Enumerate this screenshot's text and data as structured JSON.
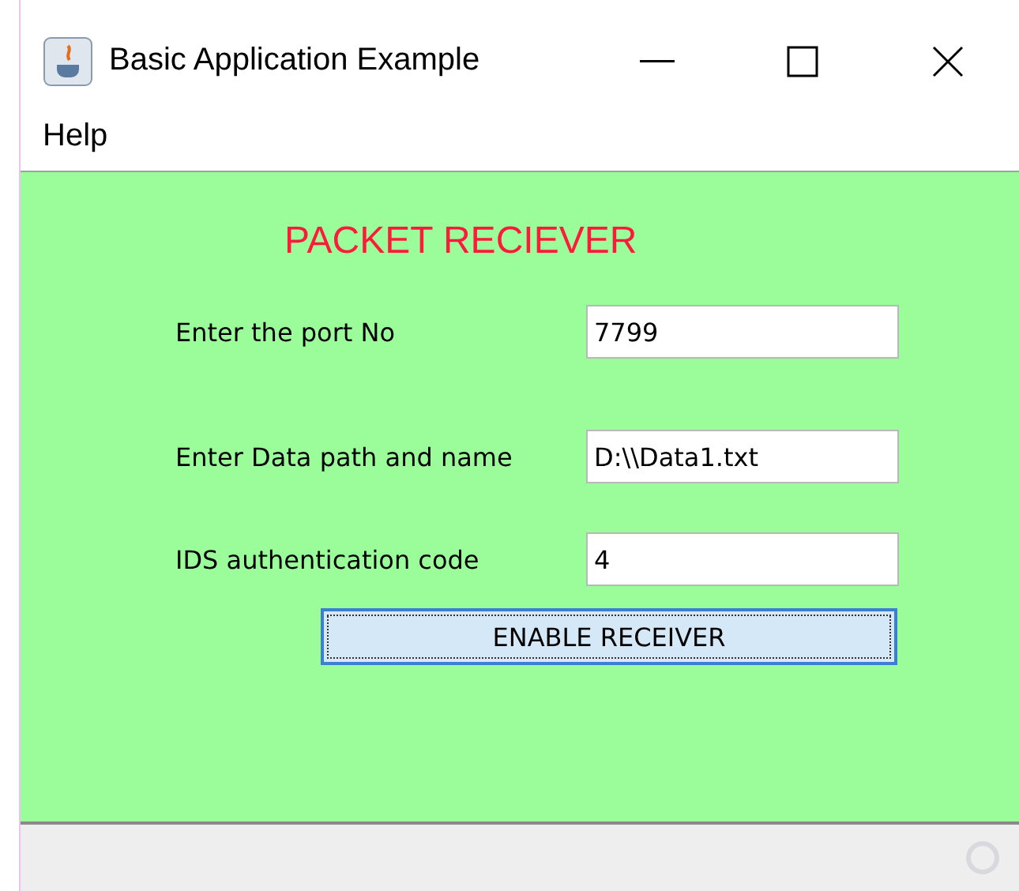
{
  "window": {
    "title": "Basic Application Example"
  },
  "menu": [
    "Help"
  ],
  "heading": "PACKET RECIEVER",
  "fields": [
    {
      "label": "Enter the port No",
      "value": "7799"
    },
    {
      "label": "Enter Data path and name",
      "value": "D:\\\\Data1.txt"
    },
    {
      "label": "IDS authentication code",
      "value": "4"
    }
  ],
  "button": {
    "label": "ENABLE RECEIVER",
    "focused": true
  }
}
